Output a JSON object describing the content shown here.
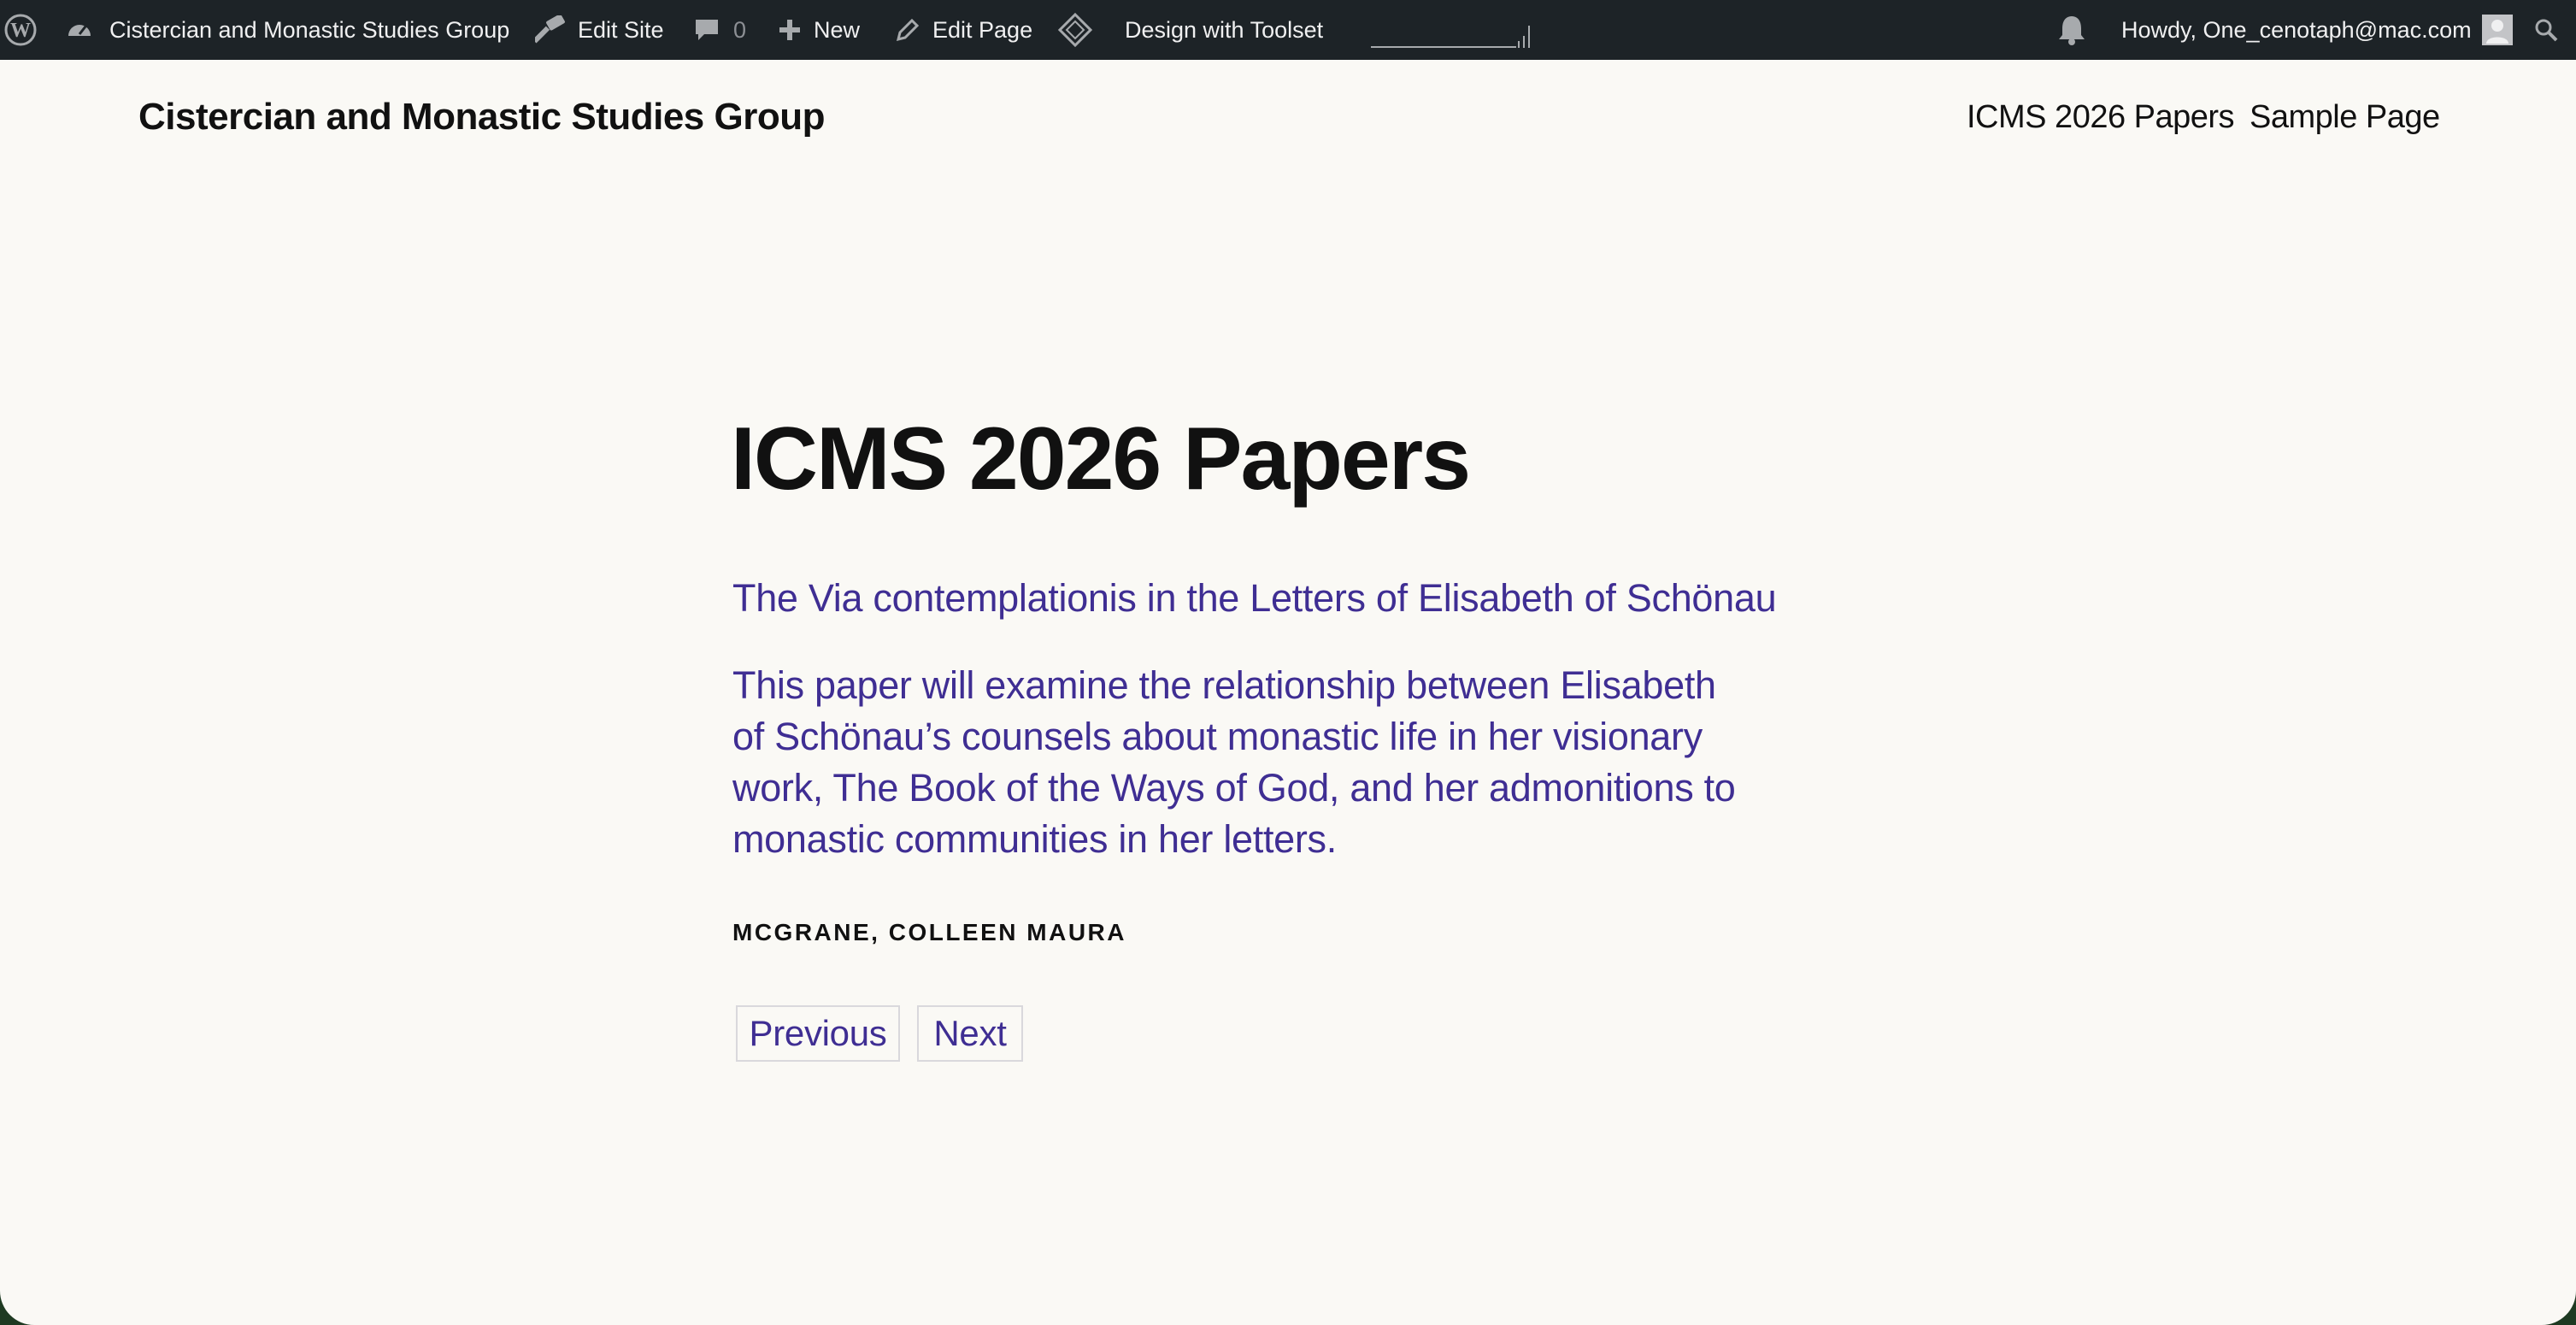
{
  "admin_bar": {
    "site_name": "Cistercian and Monastic Studies Group",
    "edit_site": "Edit Site",
    "comments_count": "0",
    "new_label": "New",
    "edit_page": "Edit Page",
    "toolset_label": "Design with Toolset",
    "greeting": "Howdy, One_cenotaph@mac.com",
    "icons": [
      "wordpress-logo-icon",
      "dashboard-icon",
      "hammer-icon",
      "comment-icon",
      "plus-icon",
      "pencil-icon",
      "toolset-icon",
      "bell-icon",
      "avatar-icon",
      "search-icon"
    ]
  },
  "header": {
    "site_title": "Cistercian and Monastic Studies Group",
    "nav": [
      "ICMS 2026 Papers",
      "Sample Page"
    ]
  },
  "main": {
    "heading": "ICMS 2026 Papers",
    "paper_title": "The Via contemplationis in the Letters of Elisabeth of Schönau",
    "abstract_lines": [
      "This paper will examine the relationship between Elisabeth",
      "of Schönau’s counsels about monastic life in her visionary",
      "work, The Book of the Ways of God, and her admonitions to",
      "monastic communities in her letters."
    ],
    "author": "MCGRANE, COLLEEN MAURA",
    "previous_label": "Previous",
    "next_label": "Next"
  },
  "colors": {
    "admin_bar_bg": "#1d2327",
    "page_bg": "#faf9f5",
    "accent": "#3f2e93",
    "text": "#111111"
  }
}
